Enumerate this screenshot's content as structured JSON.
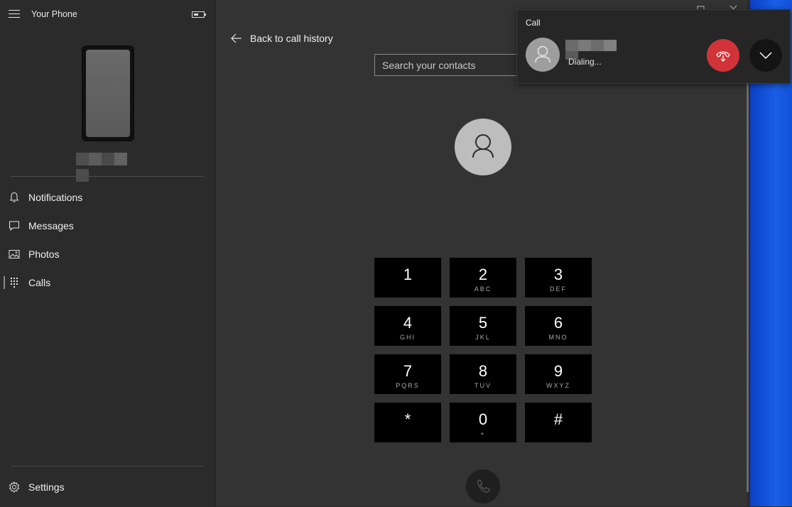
{
  "app": {
    "title": "Your Phone"
  },
  "sidebar": {
    "items": [
      {
        "label": "Notifications",
        "icon": "bell-icon"
      },
      {
        "label": "Messages",
        "icon": "message-icon"
      },
      {
        "label": "Photos",
        "icon": "photo-icon"
      },
      {
        "label": "Calls",
        "icon": "dialpad-icon",
        "active": true
      }
    ],
    "settings_label": "Settings"
  },
  "main": {
    "back_label": "Back to call history",
    "search_placeholder": "Search your contacts",
    "dialpad": [
      {
        "digit": "1",
        "letters": ""
      },
      {
        "digit": "2",
        "letters": "ABC"
      },
      {
        "digit": "3",
        "letters": "DEF"
      },
      {
        "digit": "4",
        "letters": "GHI"
      },
      {
        "digit": "5",
        "letters": "JKL"
      },
      {
        "digit": "6",
        "letters": "MNO"
      },
      {
        "digit": "7",
        "letters": "PQRS"
      },
      {
        "digit": "8",
        "letters": "TUV"
      },
      {
        "digit": "9",
        "letters": "WXYZ"
      },
      {
        "digit": "*",
        "letters": ""
      },
      {
        "digit": "0",
        "letters": "+"
      },
      {
        "digit": "#",
        "letters": ""
      }
    ]
  },
  "call_popup": {
    "title": "Call",
    "status": "Dialing...",
    "hangup_color": "#d13438"
  },
  "colors": {
    "sidebar_bg": "#2b2b2b",
    "main_bg": "#333333",
    "key_bg": "#000000",
    "desktop_accent": "#1252d8"
  }
}
